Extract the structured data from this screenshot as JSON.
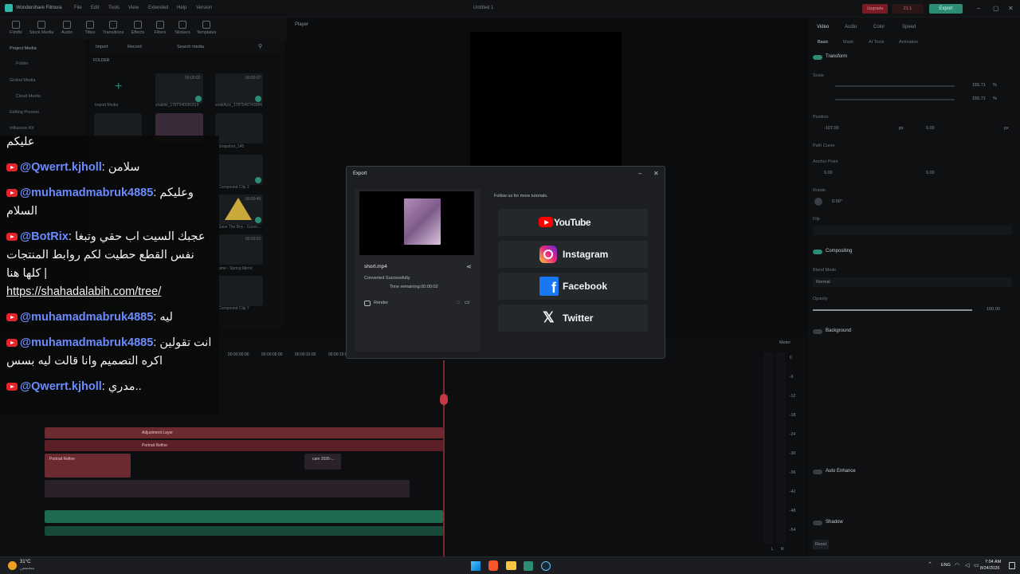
{
  "app": {
    "name": "Wondershare Filmora",
    "project_title": "Untitled 1",
    "menu": [
      "File",
      "Edit",
      "Tools",
      "View",
      "Extended",
      "Help",
      "Version"
    ],
    "upgrade_label": "Upgrade",
    "credits": "21:1",
    "export_label": "Export"
  },
  "toolbar": {
    "items": [
      "Filmfix",
      "Stock Media",
      "Audio",
      "Titles",
      "Transitions",
      "Effects",
      "Filters",
      "Stickers",
      "Templates"
    ]
  },
  "media": {
    "nav": [
      "Project Media",
      "Folder",
      "Global Media",
      "Cloud Media",
      "Editing Presets",
      "Influence Kit"
    ],
    "import_label": "Import",
    "record_label": "Record",
    "search_placeholder": "Search media",
    "folder_label": "FOLDER",
    "import_media_label": "Import Media",
    "thumb_labels": [
      "snaktix_1787540081819",
      "snakAcix_1787540743984",
      "Snapshot_145",
      "Compound Clip 2",
      "Save The Boy - Cosm...",
      "ame - Spring Mirror",
      "Compound Clip 7"
    ],
    "durations": [
      "00:00:02",
      "00:00:37",
      "00:00:45",
      "00:03:01"
    ]
  },
  "player": {
    "label": "Player"
  },
  "right_panel": {
    "tabs": [
      "Video",
      "Audio",
      "Color",
      "Speed"
    ],
    "subtabs": [
      "Basic",
      "Mask",
      "AI Tools",
      "Animation"
    ],
    "transform_label": "Transform",
    "scale_label": "Scale",
    "scale_x": "155.71",
    "scale_y": "155.71",
    "scale_unit": "%",
    "position_label": "Position",
    "position_x": "-107.00",
    "position_y": "0.00",
    "position_unit": "px",
    "path_curve_label": "Path Curve",
    "anchor_label": "Anchor Point",
    "anchor_x": "0.00",
    "anchor_y": "0.00",
    "rotate_label": "Rotate",
    "rotate_value": "0.00°",
    "flip_label": "Flip",
    "compositing_label": "Compositing",
    "blend_label": "Blend Mode",
    "blend_value": "Normal",
    "opacity_label": "Opacity",
    "opacity_value": "100.00",
    "background_label": "Background",
    "auto_enhance_label": "Auto Enhance",
    "shadow_label": "Shadow",
    "reset_label": "Reset"
  },
  "timeline": {
    "meter_label": "Meter",
    "timecodes": [
      "00:00:00:00",
      "00:00:05:00",
      "00:00:10:00",
      "00:00:15:00"
    ],
    "meter_scale": [
      "0",
      "-6",
      "-12",
      "-18",
      "-24",
      "-30",
      "-36",
      "-42",
      "-48",
      "-54"
    ],
    "lr": [
      "L",
      "R"
    ],
    "clips": {
      "adjustment": "Adjustment Layer",
      "portrait": "Portrait Refine",
      "cam_small": "cam 2026-..."
    }
  },
  "export_dialog": {
    "title": "Export",
    "file_name": "short.mp4",
    "status": "Converted Successfully",
    "time_remaining": "Time remaining:00:00:02",
    "render_label": "Render",
    "follow_text": "Follow us for more tutorials.",
    "socials": [
      {
        "name": "YouTube",
        "icon": "youtube-icon",
        "color": "#ff0000"
      },
      {
        "name": "Instagram",
        "icon": "instagram-icon",
        "color": "#d62976"
      },
      {
        "name": "Facebook",
        "icon": "facebook-icon",
        "color": "#1877f2"
      },
      {
        "name": "Twitter",
        "icon": "x-icon",
        "color": "#ffffff"
      }
    ]
  },
  "chat": {
    "messages": [
      {
        "user": "",
        "text": "عليكم"
      },
      {
        "user": "@Qwerrt.kjholl",
        "text": "سلامن"
      },
      {
        "user": "@muhamadmabruk4885",
        "text": "وعليكم السلام"
      },
      {
        "user": "@BotRix",
        "text": "عجبك السيت اب حقي وتبغا نفس القطع حطيت لكم روابط المنتجات كلها هنا |",
        "link": "https://shahadalabih.com/tree/"
      },
      {
        "user": "@muhamadmabruk4885",
        "text": "ليه"
      },
      {
        "user": "@muhamadmabruk4885",
        "text": "انت تقولين اكره التصميم وانا قالت ليه بسس"
      },
      {
        "user": "@Qwerrt.kjholl",
        "text": "مدري.."
      }
    ]
  },
  "taskbar": {
    "weather_temp": "31°C",
    "weather_desc": "مشمس",
    "lang": "ENG",
    "time": "7:04 AM",
    "date": "8/24/2026"
  }
}
